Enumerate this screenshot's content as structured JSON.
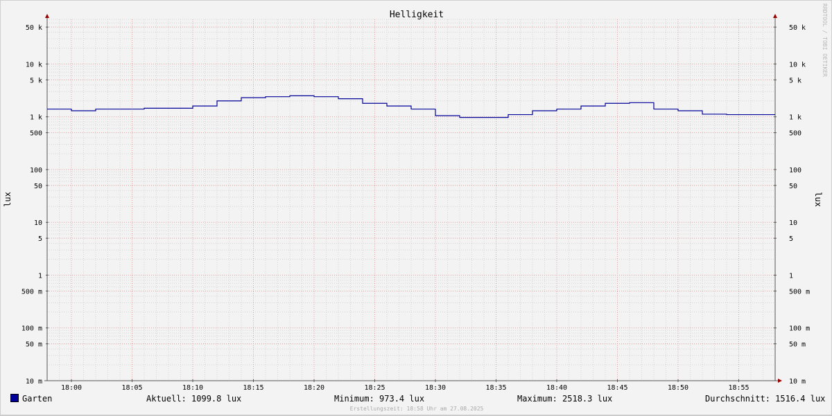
{
  "chart_data": {
    "type": "line",
    "title": "Helligkeit",
    "ylabel": "lux",
    "ylabel_right": "lux",
    "yscale": "log",
    "ylim": [
      0.01,
      70000
    ],
    "xlim": [
      "17:58",
      "18:58"
    ],
    "x_ticks": [
      "18:00",
      "18:05",
      "18:10",
      "18:15",
      "18:20",
      "18:25",
      "18:30",
      "18:35",
      "18:40",
      "18:45",
      "18:50",
      "18:55"
    ],
    "y_ticks": [
      {
        "value": 50000,
        "label": "50 k"
      },
      {
        "value": 10000,
        "label": "10 k"
      },
      {
        "value": 5000,
        "label": "5 k"
      },
      {
        "value": 1000,
        "label": "1 k"
      },
      {
        "value": 500,
        "label": "500"
      },
      {
        "value": 100,
        "label": "100"
      },
      {
        "value": 50,
        "label": "50"
      },
      {
        "value": 10,
        "label": "10"
      },
      {
        "value": 5,
        "label": "5"
      },
      {
        "value": 1,
        "label": "1"
      },
      {
        "value": 0.5,
        "label": "500 m"
      },
      {
        "value": 0.1,
        "label": "100 m"
      },
      {
        "value": 0.05,
        "label": "50 m"
      },
      {
        "value": 0.01,
        "label": "10 m"
      }
    ],
    "grid": true,
    "series": [
      {
        "name": "Garten",
        "color": "#000099",
        "x": [
          "17:58",
          "18:00",
          "18:02",
          "18:04",
          "18:06",
          "18:08",
          "18:10",
          "18:12",
          "18:14",
          "18:16",
          "18:18",
          "18:20",
          "18:22",
          "18:24",
          "18:26",
          "18:28",
          "18:30",
          "18:32",
          "18:34",
          "18:36",
          "18:38",
          "18:40",
          "18:42",
          "18:44",
          "18:46",
          "18:48",
          "18:50",
          "18:52",
          "18:54",
          "18:56"
        ],
        "values": [
          1400,
          1300,
          1400,
          1400,
          1450,
          1450,
          1600,
          2000,
          2300,
          2400,
          2500,
          2400,
          2200,
          1800,
          1600,
          1400,
          1050,
          973,
          973,
          1100,
          1300,
          1400,
          1600,
          1800,
          1850,
          1400,
          1300,
          1120,
          1100,
          1100
        ],
        "end": "18:58"
      }
    ]
  },
  "legend": {
    "series_name": "Garten",
    "current": "Aktuell: 1099.8 lux",
    "minimum": "Minimum: 973.4 lux",
    "maximum": "Maximum: 2518.3 lux",
    "average": "Durchschnitt: 1516.4 lux"
  },
  "footer": "Erstellungszeit: 18:58 Uhr am 27.08.2025",
  "watermark": "RRDTOOL / TOBI OETIKER"
}
